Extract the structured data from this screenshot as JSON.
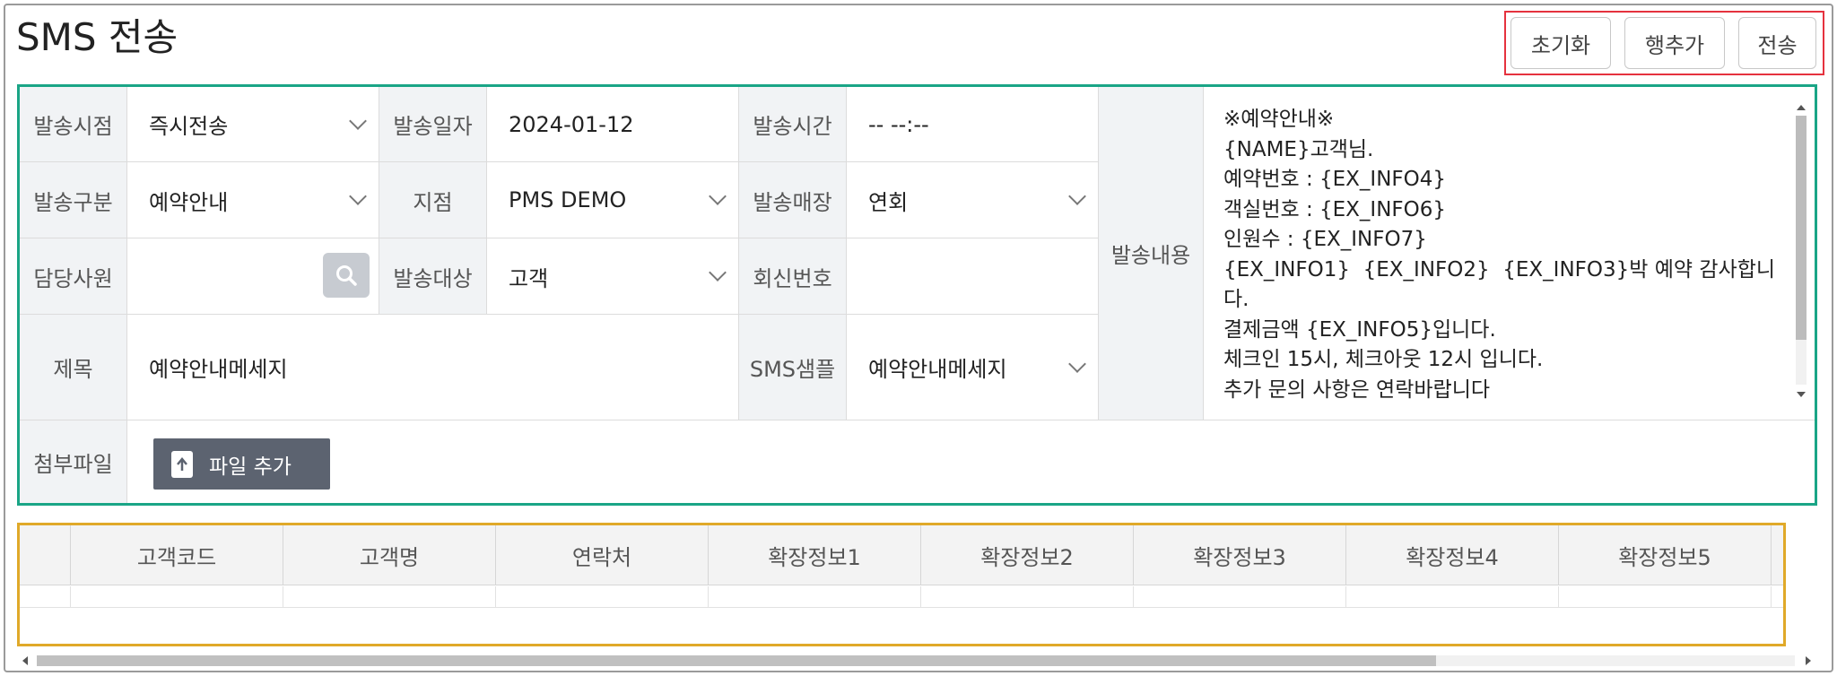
{
  "page": {
    "title": "SMS 전송"
  },
  "actions": {
    "reset": "초기화",
    "add_row": "행추가",
    "send": "전송"
  },
  "form": {
    "send_timing": {
      "label": "발송시점",
      "value": "즉시전송"
    },
    "send_date": {
      "label": "발송일자",
      "value": "2024-01-12"
    },
    "send_time": {
      "label": "발송시간",
      "value": "-- --:--"
    },
    "send_type": {
      "label": "발송구분",
      "value": "예약안내"
    },
    "branch": {
      "label": "지점",
      "value": "PMS DEMO"
    },
    "send_store": {
      "label": "발송매장",
      "value": "연회"
    },
    "staff": {
      "label": "담당사원",
      "value": ""
    },
    "target": {
      "label": "발송대상",
      "value": "고객"
    },
    "reply_number": {
      "label": "회신번호",
      "value": ""
    },
    "subject": {
      "label": "제목",
      "value": "예약안내메세지"
    },
    "sms_sample": {
      "label": "SMS샘플",
      "value": "예약안내메세지"
    },
    "content": {
      "label": "발송내용",
      "value": "※예약안내※\n{NAME}고객님.\n예약번호 : {EX_INFO4}\n객실번호 : {EX_INFO6}\n인원수 : {EX_INFO7}\n{EX_INFO1}  {EX_INFO2}  {EX_INFO3}박 예약 감사합니다.\n결제금액 {EX_INFO5}입니다.\n체크인 15시, 체크아웃 12시 입니다.\n추가 문의 사항은 연락바랍니다"
    },
    "attachment": {
      "label": "첨부파일",
      "button": "파일 추가"
    }
  },
  "grid": {
    "columns": [
      "고객코드",
      "고객명",
      "연락처",
      "확장정보1",
      "확장정보2",
      "확장정보3",
      "확장정보4",
      "확장정보5"
    ]
  },
  "colors": {
    "form_border": "#1aa586",
    "grid_border": "#e0a929",
    "action_border": "#e5323e",
    "file_button": "#5c6370"
  },
  "icons": {
    "search": "search-icon",
    "upload": "file-upload-icon",
    "dropdown": "chevron-down-icon"
  }
}
